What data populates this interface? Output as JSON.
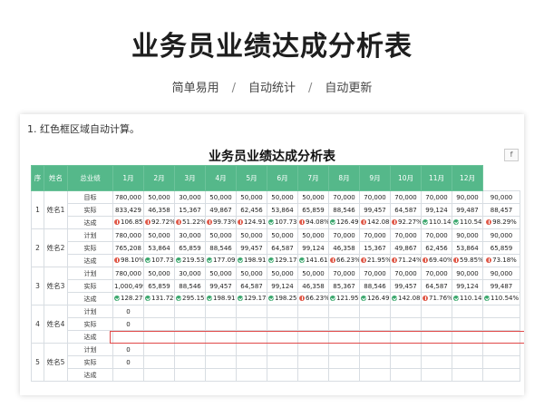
{
  "banner": {
    "title": "业务员业绩达成分析表",
    "features": [
      "简单易用",
      "自动统计",
      "自动更新"
    ],
    "separator": "/"
  },
  "sheet": {
    "note": "1. 红色框区域自动计算。",
    "title": "业务员业绩达成分析表",
    "side_button": "f",
    "headers": [
      "序",
      "姓名",
      "总业绩",
      "1月",
      "2月",
      "3月",
      "4月",
      "5月",
      "6月",
      "7月",
      "8月",
      "9月",
      "10月",
      "11月",
      "12月"
    ],
    "highlight_color": "#e04848",
    "header_color": "#55b88a",
    "rows": [
      {
        "seq": "1",
        "name": "姓名1",
        "target_label": "目标",
        "actual_label": "实际",
        "rate_label": "达成",
        "target": [
          "780,000",
          "50,000",
          "30,000",
          "50,000",
          "50,000",
          "50,000",
          "50,000",
          "70,000",
          "70,000",
          "70,000",
          "70,000",
          "90,000",
          "90,000"
        ],
        "actual": [
          "833,429",
          "46,358",
          "15,367",
          "49,867",
          "62,456",
          "53,864",
          "65,859",
          "88,546",
          "99,457",
          "64,587",
          "99,124",
          "99,487",
          "88,457"
        ],
        "rate": [
          {
            "v": "106.85%",
            "s": "down"
          },
          {
            "v": "92.72%",
            "s": "down"
          },
          {
            "v": "51.22%",
            "s": "down"
          },
          {
            "v": "99.73%",
            "s": "down"
          },
          {
            "v": "124.91%",
            "s": "down"
          },
          {
            "v": "107.73%",
            "s": "up"
          },
          {
            "v": "94.08%",
            "s": "down"
          },
          {
            "v": "126.49%",
            "s": "up"
          },
          {
            "v": "142.08%",
            "s": "down"
          },
          {
            "v": "92.27%",
            "s": "down"
          },
          {
            "v": "110.14%",
            "s": "up"
          },
          {
            "v": "110.54%",
            "s": "up"
          },
          {
            "v": "98.29%",
            "s": "down"
          }
        ]
      },
      {
        "seq": "2",
        "name": "姓名2",
        "target_label": "计划",
        "actual_label": "实际",
        "rate_label": "达成",
        "target": [
          "780,000",
          "50,000",
          "30,000",
          "50,000",
          "50,000",
          "50,000",
          "50,000",
          "70,000",
          "70,000",
          "70,000",
          "70,000",
          "90,000",
          "90,000"
        ],
        "actual": [
          "765,208",
          "53,864",
          "65,859",
          "88,546",
          "99,457",
          "64,587",
          "99,124",
          "46,358",
          "15,367",
          "49,867",
          "62,456",
          "53,864",
          "65,859"
        ],
        "rate": [
          {
            "v": "98.10%",
            "s": "down"
          },
          {
            "v": "107.73%",
            "s": "up"
          },
          {
            "v": "219.53%",
            "s": "up"
          },
          {
            "v": "177.09%",
            "s": "up"
          },
          {
            "v": "198.91%",
            "s": "up"
          },
          {
            "v": "129.17%",
            "s": "up"
          },
          {
            "v": "141.61%",
            "s": "up"
          },
          {
            "v": "66.23%",
            "s": "down"
          },
          {
            "v": "21.95%",
            "s": "down"
          },
          {
            "v": "71.24%",
            "s": "down"
          },
          {
            "v": "69.40%",
            "s": "down"
          },
          {
            "v": "59.85%",
            "s": "down"
          },
          {
            "v": "73.18%",
            "s": "down"
          }
        ]
      },
      {
        "seq": "3",
        "name": "姓名3",
        "target_label": "计划",
        "actual_label": "实际",
        "rate_label": "达成",
        "target": [
          "780,000",
          "50,000",
          "30,000",
          "50,000",
          "50,000",
          "50,000",
          "50,000",
          "70,000",
          "70,000",
          "70,000",
          "70,000",
          "90,000",
          "90,000"
        ],
        "actual": [
          "1,000,499",
          "65,859",
          "88,546",
          "99,457",
          "64,587",
          "99,124",
          "46,358",
          "85,367",
          "88,546",
          "99,457",
          "64,587",
          "99,124",
          "99,487"
        ],
        "rate": [
          {
            "v": "128.27%",
            "s": "up"
          },
          {
            "v": "131.72%",
            "s": "up"
          },
          {
            "v": "295.15%",
            "s": "up"
          },
          {
            "v": "198.91%",
            "s": "up"
          },
          {
            "v": "129.17%",
            "s": "up"
          },
          {
            "v": "198.25%",
            "s": "up"
          },
          {
            "v": "66.23%",
            "s": "down"
          },
          {
            "v": "121.95%",
            "s": "up"
          },
          {
            "v": "126.49%",
            "s": "up"
          },
          {
            "v": "142.08%",
            "s": "up"
          },
          {
            "v": "71.76%",
            "s": "down"
          },
          {
            "v": "110.14%",
            "s": "up"
          },
          {
            "v": "110.54%",
            "s": "up"
          }
        ]
      },
      {
        "seq": "4",
        "name": "姓名4",
        "target_label": "计划",
        "actual_label": "实际",
        "rate_label": "达成",
        "target": [
          "0"
        ],
        "actual": [
          "0"
        ],
        "rate": []
      },
      {
        "seq": "5",
        "name": "姓名5",
        "target_label": "计划",
        "actual_label": "实际",
        "rate_label": "达成",
        "target": [
          "0"
        ],
        "actual": [
          "0"
        ],
        "rate": []
      }
    ]
  }
}
